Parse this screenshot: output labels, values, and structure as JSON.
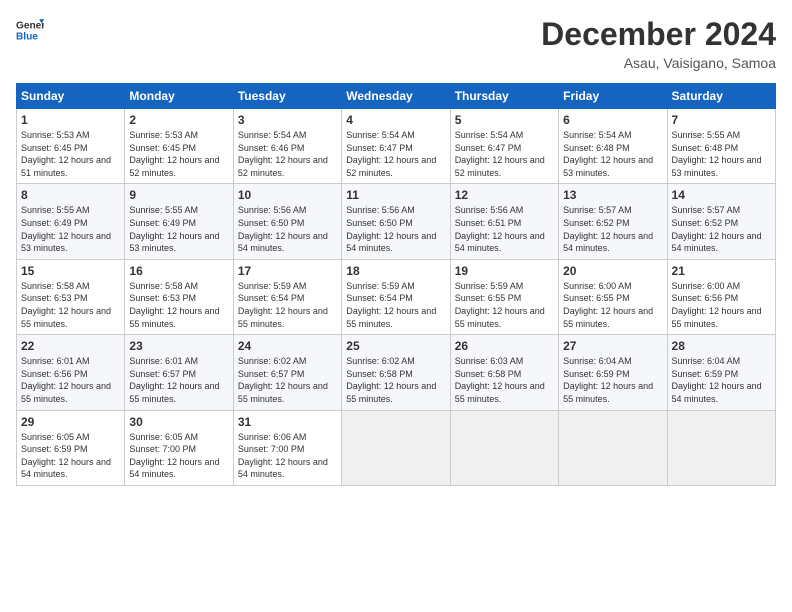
{
  "header": {
    "logo": {
      "general": "General",
      "blue": "Blue"
    },
    "title": "December 2024",
    "location": "Asau, Vaisigano, Samoa"
  },
  "calendar": {
    "weekdays": [
      "Sunday",
      "Monday",
      "Tuesday",
      "Wednesday",
      "Thursday",
      "Friday",
      "Saturday"
    ],
    "weeks": [
      [
        {
          "day": 1,
          "sunrise": "5:53 AM",
          "sunset": "6:45 PM",
          "daylight": "12 hours and 51 minutes."
        },
        {
          "day": 2,
          "sunrise": "5:53 AM",
          "sunset": "6:45 PM",
          "daylight": "12 hours and 52 minutes."
        },
        {
          "day": 3,
          "sunrise": "5:54 AM",
          "sunset": "6:46 PM",
          "daylight": "12 hours and 52 minutes."
        },
        {
          "day": 4,
          "sunrise": "5:54 AM",
          "sunset": "6:47 PM",
          "daylight": "12 hours and 52 minutes."
        },
        {
          "day": 5,
          "sunrise": "5:54 AM",
          "sunset": "6:47 PM",
          "daylight": "12 hours and 52 minutes."
        },
        {
          "day": 6,
          "sunrise": "5:54 AM",
          "sunset": "6:48 PM",
          "daylight": "12 hours and 53 minutes."
        },
        {
          "day": 7,
          "sunrise": "5:55 AM",
          "sunset": "6:48 PM",
          "daylight": "12 hours and 53 minutes."
        }
      ],
      [
        {
          "day": 8,
          "sunrise": "5:55 AM",
          "sunset": "6:49 PM",
          "daylight": "12 hours and 53 minutes."
        },
        {
          "day": 9,
          "sunrise": "5:55 AM",
          "sunset": "6:49 PM",
          "daylight": "12 hours and 53 minutes."
        },
        {
          "day": 10,
          "sunrise": "5:56 AM",
          "sunset": "6:50 PM",
          "daylight": "12 hours and 54 minutes."
        },
        {
          "day": 11,
          "sunrise": "5:56 AM",
          "sunset": "6:50 PM",
          "daylight": "12 hours and 54 minutes."
        },
        {
          "day": 12,
          "sunrise": "5:56 AM",
          "sunset": "6:51 PM",
          "daylight": "12 hours and 54 minutes."
        },
        {
          "day": 13,
          "sunrise": "5:57 AM",
          "sunset": "6:52 PM",
          "daylight": "12 hours and 54 minutes."
        },
        {
          "day": 14,
          "sunrise": "5:57 AM",
          "sunset": "6:52 PM",
          "daylight": "12 hours and 54 minutes."
        }
      ],
      [
        {
          "day": 15,
          "sunrise": "5:58 AM",
          "sunset": "6:53 PM",
          "daylight": "12 hours and 55 minutes."
        },
        {
          "day": 16,
          "sunrise": "5:58 AM",
          "sunset": "6:53 PM",
          "daylight": "12 hours and 55 minutes."
        },
        {
          "day": 17,
          "sunrise": "5:59 AM",
          "sunset": "6:54 PM",
          "daylight": "12 hours and 55 minutes."
        },
        {
          "day": 18,
          "sunrise": "5:59 AM",
          "sunset": "6:54 PM",
          "daylight": "12 hours and 55 minutes."
        },
        {
          "day": 19,
          "sunrise": "5:59 AM",
          "sunset": "6:55 PM",
          "daylight": "12 hours and 55 minutes."
        },
        {
          "day": 20,
          "sunrise": "6:00 AM",
          "sunset": "6:55 PM",
          "daylight": "12 hours and 55 minutes."
        },
        {
          "day": 21,
          "sunrise": "6:00 AM",
          "sunset": "6:56 PM",
          "daylight": "12 hours and 55 minutes."
        }
      ],
      [
        {
          "day": 22,
          "sunrise": "6:01 AM",
          "sunset": "6:56 PM",
          "daylight": "12 hours and 55 minutes."
        },
        {
          "day": 23,
          "sunrise": "6:01 AM",
          "sunset": "6:57 PM",
          "daylight": "12 hours and 55 minutes."
        },
        {
          "day": 24,
          "sunrise": "6:02 AM",
          "sunset": "6:57 PM",
          "daylight": "12 hours and 55 minutes."
        },
        {
          "day": 25,
          "sunrise": "6:02 AM",
          "sunset": "6:58 PM",
          "daylight": "12 hours and 55 minutes."
        },
        {
          "day": 26,
          "sunrise": "6:03 AM",
          "sunset": "6:58 PM",
          "daylight": "12 hours and 55 minutes."
        },
        {
          "day": 27,
          "sunrise": "6:04 AM",
          "sunset": "6:59 PM",
          "daylight": "12 hours and 55 minutes."
        },
        {
          "day": 28,
          "sunrise": "6:04 AM",
          "sunset": "6:59 PM",
          "daylight": "12 hours and 54 minutes."
        }
      ],
      [
        {
          "day": 29,
          "sunrise": "6:05 AM",
          "sunset": "6:59 PM",
          "daylight": "12 hours and 54 minutes."
        },
        {
          "day": 30,
          "sunrise": "6:05 AM",
          "sunset": "7:00 PM",
          "daylight": "12 hours and 54 minutes."
        },
        {
          "day": 31,
          "sunrise": "6:06 AM",
          "sunset": "7:00 PM",
          "daylight": "12 hours and 54 minutes."
        },
        null,
        null,
        null,
        null
      ]
    ]
  }
}
